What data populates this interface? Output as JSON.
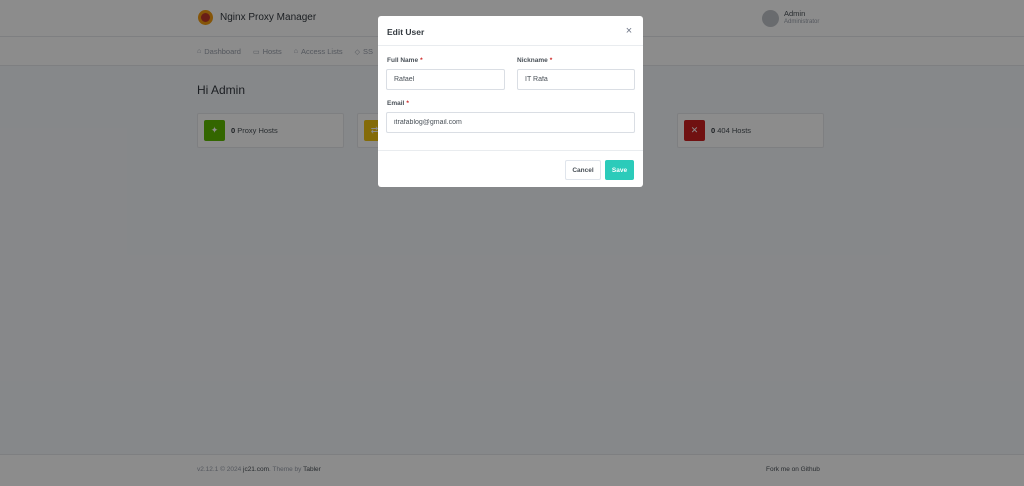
{
  "app": {
    "brand_name": "Nginx Proxy Manager",
    "user_name": "Admin",
    "user_role": "Administrator"
  },
  "nav": {
    "items": [
      {
        "label": "Dashboard",
        "icon": "home-icon"
      },
      {
        "label": "Hosts",
        "icon": "monitor-icon"
      },
      {
        "label": "Access Lists",
        "icon": "lock-icon"
      },
      {
        "label": "SS",
        "icon": "shield-icon"
      }
    ]
  },
  "dashboard": {
    "greeting": "Hi Admin",
    "stats": [
      {
        "count": "0",
        "label": "Proxy Hosts",
        "color": "#5eba00",
        "icon": "zap-icon"
      },
      {
        "count": "",
        "label": "",
        "color": "#f1c40f",
        "icon": "shuffle-icon"
      },
      {
        "count": "0",
        "label": "404 Hosts",
        "color": "#cd201f",
        "icon": "zap-off-icon"
      }
    ]
  },
  "footer": {
    "version": "v2.12.1 © 2024",
    "company": "jc21.com",
    "theme_prefix": ". Theme by",
    "theme": "Tabler",
    "github": "Fork me on Github"
  },
  "modal": {
    "title": "Edit User",
    "close_glyph": "×",
    "full_name_label": "Full Name",
    "full_name_value": "Rafael",
    "nickname_label": "Nickname",
    "nickname_value": "IT Rafa",
    "email_label": "Email",
    "email_value": "itrafablog@gmail.com",
    "required_mark": "*",
    "cancel_label": "Cancel",
    "save_label": "Save"
  },
  "colors": {
    "accent": "#2bcbba",
    "required": "#cd201f"
  }
}
